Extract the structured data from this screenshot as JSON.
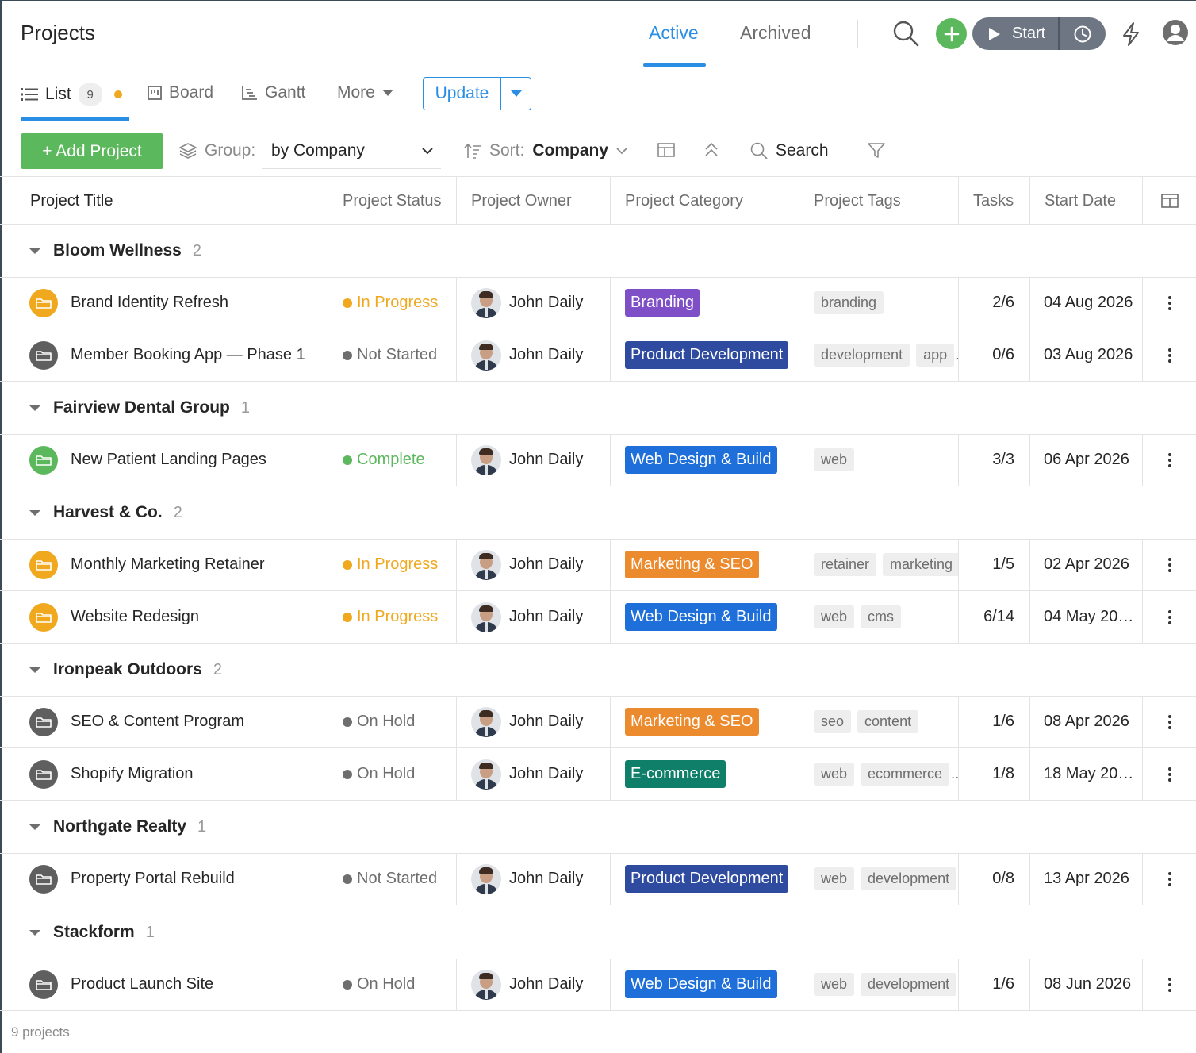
{
  "header": {
    "title": "Projects",
    "tabs": {
      "active": "Active",
      "archived": "Archived"
    },
    "start_label": "Start"
  },
  "views": {
    "list_label": "List",
    "list_count": "9",
    "board_label": "Board",
    "gantt_label": "Gantt",
    "more_label": "More",
    "update_label": "Update"
  },
  "toolbar": {
    "add_label": "+ Add Project",
    "group_label": "Group:",
    "group_value": "by Company",
    "sort_label": "Sort:",
    "sort_value": "Company",
    "search_label": "Search"
  },
  "columns": {
    "title": "Project Title",
    "status": "Project Status",
    "owner": "Project Owner",
    "category": "Project Category",
    "tags": "Project Tags",
    "tasks": "Tasks",
    "start": "Start Date"
  },
  "colors": {
    "accent": "#2b8ee5",
    "green": "#5cb85c",
    "in_progress": "#f0a81f",
    "not_started": "#6e6e6e",
    "complete": "#5cb85c",
    "on_hold": "#6e6e6e",
    "branding": "#7e4fc6",
    "product_dev": "#2f4ba0",
    "web_design": "#1e6fd9",
    "marketing_seo": "#ec8a2e",
    "ecommerce": "#0f7f6a"
  },
  "groups": [
    {
      "name": "Bloom Wellness",
      "count": "2"
    },
    {
      "name": "Fairview Dental Group",
      "count": "1"
    },
    {
      "name": "Harvest & Co.",
      "count": "2"
    },
    {
      "name": "Ironpeak Outdoors",
      "count": "2"
    },
    {
      "name": "Northgate Realty",
      "count": "1"
    },
    {
      "name": "Stackform",
      "count": "1"
    }
  ],
  "rows": [
    {
      "title": "Brand Identity Refresh",
      "status": "In Progress",
      "owner": "John Daily",
      "category": "Branding",
      "tags": [
        "branding"
      ],
      "tags_more": "",
      "tasks": "2/6",
      "start": "04 Aug 2026"
    },
    {
      "title": "Member Booking App — Phase 1",
      "status": "Not Started",
      "owner": "John Daily",
      "category": "Product Development",
      "tags": [
        "development",
        "app"
      ],
      "tags_more": "..",
      "tasks": "0/6",
      "start": "03 Aug 2026"
    },
    {
      "title": "New Patient Landing Pages",
      "status": "Complete",
      "owner": "John Daily",
      "category": "Web Design & Build",
      "tags": [
        "web"
      ],
      "tags_more": "",
      "tasks": "3/3",
      "start": "06 Apr 2026"
    },
    {
      "title": "Monthly Marketing Retainer",
      "status": "In Progress",
      "owner": "John Daily",
      "category": "Marketing & SEO",
      "tags": [
        "retainer",
        "marketing"
      ],
      "tags_more": "",
      "tasks": "1/5",
      "start": "02 Apr 2026"
    },
    {
      "title": "Website Redesign",
      "status": "In Progress",
      "owner": "John Daily",
      "category": "Web Design & Build",
      "tags": [
        "web",
        "cms"
      ],
      "tags_more": "",
      "tasks": "6/14",
      "start": "04 May 20…"
    },
    {
      "title": "SEO & Content Program",
      "status": "On Hold",
      "owner": "John Daily",
      "category": "Marketing & SEO",
      "tags": [
        "seo",
        "content"
      ],
      "tags_more": "",
      "tasks": "1/6",
      "start": "08 Apr 2026"
    },
    {
      "title": "Shopify Migration",
      "status": "On Hold",
      "owner": "John Daily",
      "category": "E-commerce",
      "tags": [
        "web",
        "ecommerce"
      ],
      "tags_more": "...",
      "tasks": "1/8",
      "start": "18 May 20…"
    },
    {
      "title": "Property Portal Rebuild",
      "status": "Not Started",
      "owner": "John Daily",
      "category": "Product Development",
      "tags": [
        "web",
        "development"
      ],
      "tags_more": ".",
      "tasks": "0/8",
      "start": "13 Apr 2026"
    },
    {
      "title": "Product Launch Site",
      "status": "On Hold",
      "owner": "John Daily",
      "category": "Web Design & Build",
      "tags": [
        "web",
        "development"
      ],
      "tags_more": ".",
      "tasks": "1/6",
      "start": "08 Jun 2026"
    }
  ],
  "footer": "9 projects"
}
